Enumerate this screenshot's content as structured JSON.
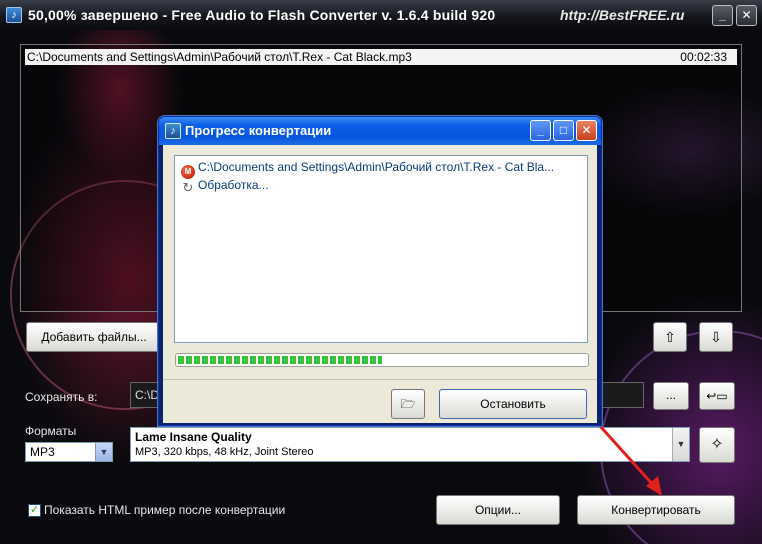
{
  "main_window": {
    "title": "50,00% завершено - Free Audio to Flash Converter  v. 1.6.4 build 920",
    "watermark": "http://BestFREE.ru",
    "file_list": [
      {
        "path": "C:\\Documents and Settings\\Admin\\Рабочий стол\\T.Rex - Cat Black.mp3",
        "duration": "00:02:33"
      }
    ],
    "add_files_label": "Добавить файлы...",
    "save_to_label": "Сохранять в:",
    "save_path_value": "C:\\D",
    "browse_label": "...",
    "formats_label": "Форматы",
    "format_selected": "MP3",
    "quality_title": "Lame Insane Quality",
    "quality_details": "MP3, 320 kbps, 48 kHz, Joint Stereo",
    "show_html_label": "Показать HTML пример после конвертации",
    "show_html_checked": true,
    "options_label": "Опции...",
    "convert_label": "Конвертировать"
  },
  "progress_dialog": {
    "title": "Прогресс конвертации",
    "log": [
      {
        "icon": "mp3-file-icon",
        "text": "C:\\Documents and Settings\\Admin\\Рабочий стол\\T.Rex - Cat Bla..."
      },
      {
        "icon": "processing-icon",
        "text": "Обработка..."
      }
    ],
    "progress_fraction": 0.5,
    "stop_label": "Остановить"
  },
  "colors": {
    "dialog_title": "#0c5ee6",
    "progress_green": "#37c337",
    "arrow_red": "#e0201a"
  }
}
